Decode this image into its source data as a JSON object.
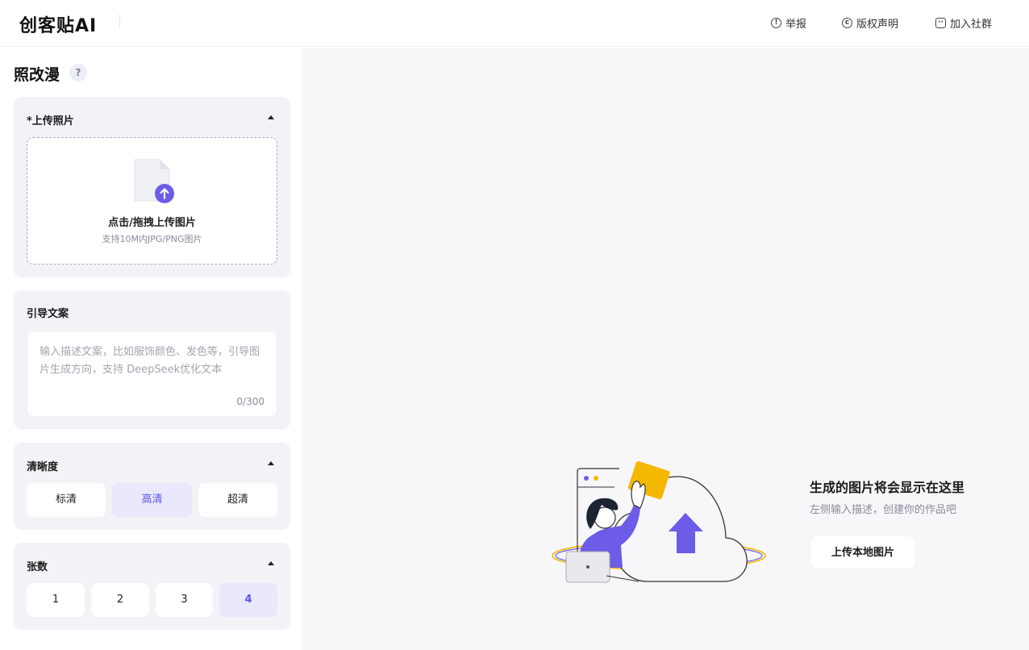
{
  "header": {
    "logo": "创客贴AI",
    "nav": [
      {
        "label": "举报",
        "icon": "info-circle-icon"
      },
      {
        "label": "版权声明",
        "icon": "copyright-icon"
      },
      {
        "label": "加入社群",
        "icon": "chat-icon"
      }
    ]
  },
  "sidebar": {
    "title": "照改漫",
    "help": "?",
    "upload": {
      "title": "*上传照片",
      "main": "点击/拖拽上传图片",
      "sub": "支持10M内JPG/PNG图片"
    },
    "prompt": {
      "title": "引导文案",
      "placeholder": "输入描述文案，比如服饰颜色、发色等，引导图片生成方向，支持 DeepSeek优化文本",
      "counter": "0/300"
    },
    "quality": {
      "title": "清晰度",
      "options": [
        "标清",
        "高清",
        "超清"
      ],
      "selected": "高清"
    },
    "count": {
      "title": "张数",
      "options": [
        "1",
        "2",
        "3",
        "4"
      ],
      "selected": "4"
    }
  },
  "main": {
    "empty_title": "生成的图片将会显示在这里",
    "empty_sub": "左侧输入描述，创建你的作品吧",
    "upload_button": "上传本地图片"
  },
  "colors": {
    "accent": "#5b55e8",
    "accent_bg": "#e9e8fc",
    "illus_purple": "#6c5ce7",
    "illus_yellow": "#f5b800"
  }
}
